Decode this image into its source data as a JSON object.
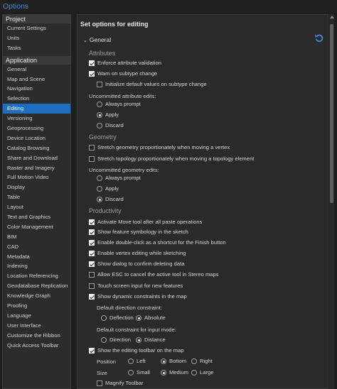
{
  "window": {
    "title": "Options"
  },
  "sidebar": {
    "groups": [
      {
        "label": "Project",
        "items": [
          "Current Settings",
          "Units",
          "Tasks"
        ]
      },
      {
        "label": "Application",
        "items": [
          "General",
          "Map and Scene",
          "Navigation",
          "Selection",
          "Editing",
          "Versioning",
          "Geoprocessing",
          "Device Location",
          "Catalog Browsing",
          "Share and Download",
          "Raster and Imagery",
          "Full Motion Video",
          "Display",
          "Table",
          "Layout",
          "Text and Graphics",
          "Color Management",
          "BIM",
          "CAD",
          "Metadata",
          "Indexing",
          "Location Referencing",
          "Geodatabase Replication",
          "Knowledge Graph",
          "Proofing",
          "Language",
          "User Interface",
          "Customize the Ribbon",
          "Quick Access Toolbar"
        ]
      }
    ],
    "selected": "Editing"
  },
  "main": {
    "heading": "Set options for editing",
    "general_label": "General",
    "undo_icon": "reset-icon",
    "attributes": {
      "title": "Attributes",
      "enforce": "Enforce attribute validation",
      "warn": "Warn on subtype change",
      "init": "Initialize default values on subtype change",
      "uncommitted_label": "Uncommitted attribute edits:",
      "opt_prompt": "Always prompt",
      "opt_apply": "Apply",
      "opt_discard": "Discard"
    },
    "geometry": {
      "title": "Geometry",
      "stretch_geom": "Stretch geometry proportionately when moving a vertex",
      "stretch_topo": "Stretch topology proportionately when moving a topology element",
      "uncommitted_label": "Uncommitted geometry edits:",
      "opt_prompt": "Always prompt",
      "opt_apply": "Apply",
      "opt_discard": "Discard"
    },
    "productivity": {
      "title": "Productivity",
      "move_tool": "Activate Move tool after all paste operations",
      "feature_symbology": "Show feature symbology in the sketch",
      "double_click": "Enable double-click as a shortcut for the Finish button",
      "vertex_editing": "Enable vertex editing while sketching",
      "confirm_delete": "Show dialog to confirm deleting data",
      "esc_cancel": "Allow ESC to cancel the active tool in Stereo maps",
      "touch_screen": "Touch screen input for new features",
      "dynamic_constraints": "Show dynamic constraints in the map",
      "default_direction_label": "Default direction constraint:",
      "deflection": "Deflection",
      "absolute": "Absolute",
      "default_input_label": "Default constraint for input mode:",
      "direction": "Direction",
      "distance": "Distance",
      "editing_toolbar": "Show the editing toolbar on the map",
      "position_label": "Position",
      "left": "Left",
      "bottom": "Bottom",
      "right": "Right",
      "size_label": "Size",
      "small": "Small",
      "medium": "Medium",
      "large": "Large",
      "magnify": "Magnify Toolbar"
    }
  }
}
